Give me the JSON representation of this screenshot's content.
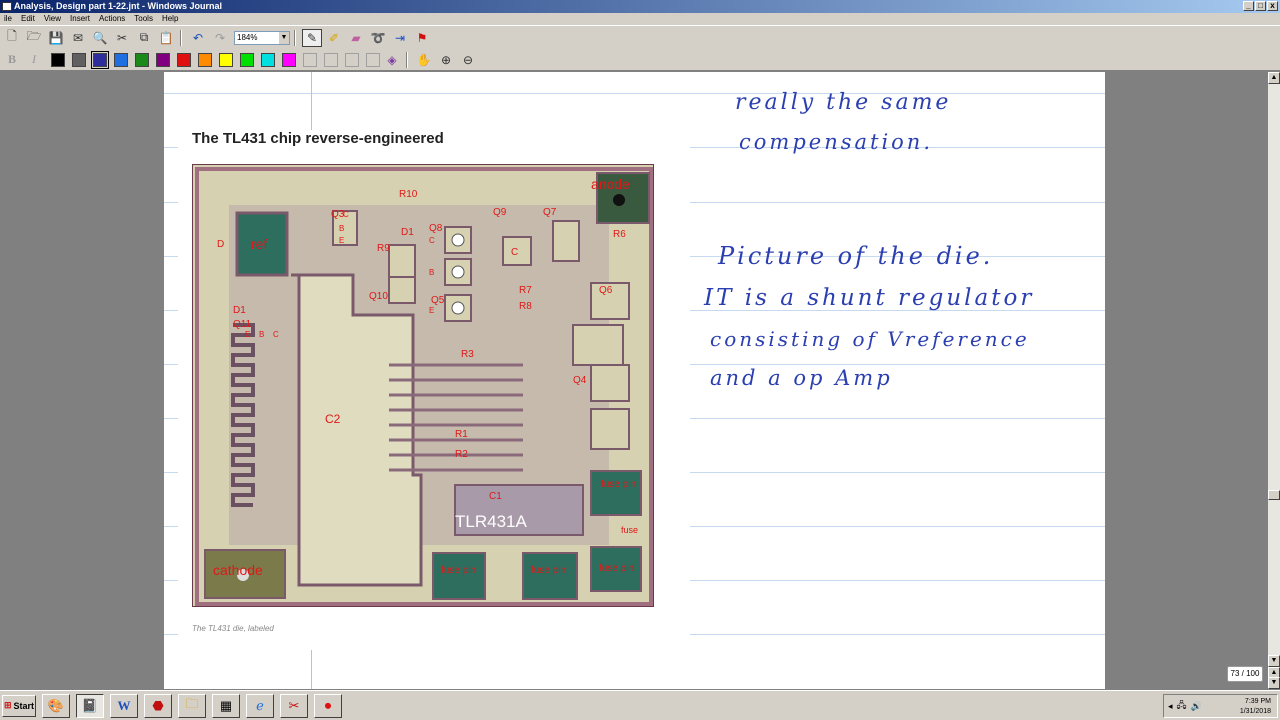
{
  "window": {
    "title": "Analysis, Design part 1-22.jnt - Windows Journal",
    "minimize": "_",
    "maximize": "□",
    "close": "x"
  },
  "menu": [
    "ile",
    "Edit",
    "View",
    "Insert",
    "Actions",
    "Tools",
    "Help"
  ],
  "toolbar": {
    "zoom": "184%"
  },
  "colors": {
    "palette": [
      "#000000",
      "#606060",
      "#2c2c9c",
      "#1e6fe0",
      "#1a8a1a",
      "#800080",
      "#e01010",
      "#ff8c00",
      "#ffff00",
      "#00e000",
      "#00e0e0",
      "#ff00ff"
    ],
    "ink": "#2b3fb0"
  },
  "clip": {
    "title": "The TL431 chip reverse-engineered",
    "caption": "The TL431 die, labeled",
    "die_labels": [
      "anode",
      "R10",
      "Q3",
      "C",
      "B",
      "E",
      "Q9",
      "Q7",
      "D",
      "ref",
      "R9",
      "D1",
      "Q8",
      "C",
      "B",
      "E",
      "Q10",
      "C",
      "R7",
      "R8",
      "Q5",
      "D1",
      "Q11",
      "R6",
      "C",
      "B",
      "E",
      "Q6",
      "Q4",
      "C2",
      "R3",
      "R1",
      "R2",
      "C1",
      "TLR431A",
      "fuse pin",
      "cathode",
      "fuse pin",
      "fuse pin",
      "fuse pin",
      "fuse"
    ]
  },
  "ink": {
    "line1": "really the same",
    "line2": "compensation.",
    "line3": "Picture of the die.",
    "line4": "IT is a shunt regulator",
    "line5": "consisting of Vreference",
    "line6": "and a op Amp"
  },
  "status": {
    "page_count": "73 / 100",
    "start": "Start",
    "time": "7:39 PM",
    "date": "1/31/2018"
  }
}
